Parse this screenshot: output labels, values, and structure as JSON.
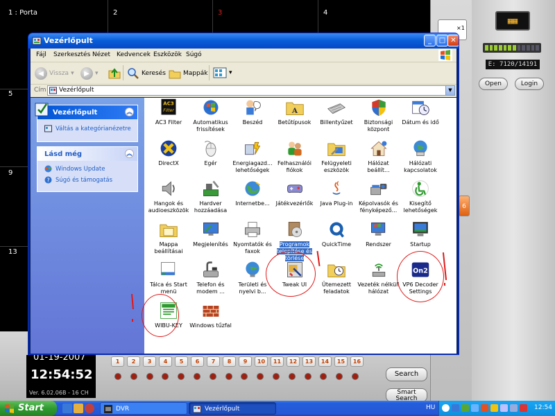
{
  "dvr": {
    "channels": [
      "1 : Porta",
      "2",
      "3",
      "4",
      "5",
      "9",
      "13"
    ],
    "date": "01-19-2007",
    "time": "12:54:52",
    "version": "Ver. 6.02.06B - 16 CH",
    "disk": "E: 7120/14191",
    "open_label": "Open",
    "login_label": "Login",
    "x1_label": "×1",
    "side_num": "6",
    "camera_numbers": [
      "1",
      "2",
      "3",
      "4",
      "5",
      "6",
      "7",
      "8",
      "9",
      "10",
      "11",
      "12",
      "13",
      "14",
      "15",
      "16"
    ],
    "search_label": "Search",
    "smart_label": "Smart\nSearch"
  },
  "window": {
    "title": "Vezérlőpult",
    "menu": [
      "Fájl",
      "Szerkesztés",
      "Nézet",
      "Kedvencek",
      "Eszközök",
      "Súgó"
    ],
    "toolbar": {
      "back": "Vissza",
      "search": "Keresés",
      "folders": "Mappák"
    },
    "address_label": "Cím",
    "address_value": "Vezérlőpult"
  },
  "sidebar": {
    "main_title": "Vezérlőpult",
    "switch_link": "Váltás a kategórianézetre",
    "see_also_title": "Lásd még",
    "see_also": [
      "Windows Update",
      "Súgó és támogatás"
    ]
  },
  "icons": [
    {
      "label": "AC3 Filter",
      "icon": "ac3-filter-icon"
    },
    {
      "label": "Automatikus frissítések",
      "icon": "windows-shield-icon"
    },
    {
      "label": "Beszéd",
      "icon": "speech-icon"
    },
    {
      "label": "Betűtípusok",
      "icon": "fonts-folder-icon"
    },
    {
      "label": "Billentyűzet",
      "icon": "keyboard-icon"
    },
    {
      "label": "Biztonsági központ",
      "icon": "security-shield-icon"
    },
    {
      "label": "Dátum és idő",
      "icon": "clock-icon"
    },
    {
      "label": "DirectX",
      "icon": "directx-icon"
    },
    {
      "label": "Egér",
      "icon": "mouse-icon"
    },
    {
      "label": "Energiagazd... lehetőségek",
      "icon": "power-icon"
    },
    {
      "label": "Felhasználói fiókok",
      "icon": "users-icon"
    },
    {
      "label": "Felügyeleti eszközök",
      "icon": "admin-tools-icon"
    },
    {
      "label": "Hálózat beállít...",
      "icon": "network-house-icon"
    },
    {
      "label": "Hálózati kapcsolatok",
      "icon": "network-globe-icon"
    },
    {
      "label": "Hangok és audioeszközök",
      "icon": "speaker-icon"
    },
    {
      "label": "Hardver hozzáadása",
      "icon": "hardware-icon"
    },
    {
      "label": "Internetbe...",
      "icon": "internet-globe-icon"
    },
    {
      "label": "Játékvezérlők",
      "icon": "gamepad-icon"
    },
    {
      "label": "Java Plug-in",
      "icon": "java-icon"
    },
    {
      "label": "Képolvasók és fényképező...",
      "icon": "scanner-icon"
    },
    {
      "label": "Kisegítő lehetőségek",
      "icon": "accessibility-icon"
    },
    {
      "label": "Mappa beállításai",
      "icon": "folder-options-icon"
    },
    {
      "label": "Megjelenítés",
      "icon": "display-icon"
    },
    {
      "label": "Nyomtatók és faxok",
      "icon": "printer-icon"
    },
    {
      "label": "Programok telepítése és törlése",
      "icon": "add-remove-icon"
    },
    {
      "label": "QuickTime",
      "icon": "quicktime-icon"
    },
    {
      "label": "Rendszer",
      "icon": "system-icon"
    },
    {
      "label": "Startup",
      "icon": "startup-monitor-icon"
    },
    {
      "label": "Tálca és Start menü",
      "icon": "taskbar-icon"
    },
    {
      "label": "Telefon és modem ...",
      "icon": "phone-icon"
    },
    {
      "label": "Területi és nyelvi b...",
      "icon": "regional-globe-icon"
    },
    {
      "label": "Tweak UI",
      "icon": "tweakui-icon"
    },
    {
      "label": "Ütemezett feladatok",
      "icon": "scheduled-tasks-icon"
    },
    {
      "label": "Vezeték nélküli hálózat",
      "icon": "wireless-icon"
    },
    {
      "label": "VP6 Decoder Settings",
      "icon": "vp6-icon"
    },
    {
      "label": "WIBU-KEY",
      "icon": "wibu-key-icon"
    },
    {
      "label": "Windows tűzfal",
      "icon": "firewall-icon"
    }
  ],
  "taskbar": {
    "start": "Start",
    "items": [
      "DVR",
      "Vezérlőpult"
    ],
    "lang": "HU",
    "clock": "12:54"
  }
}
